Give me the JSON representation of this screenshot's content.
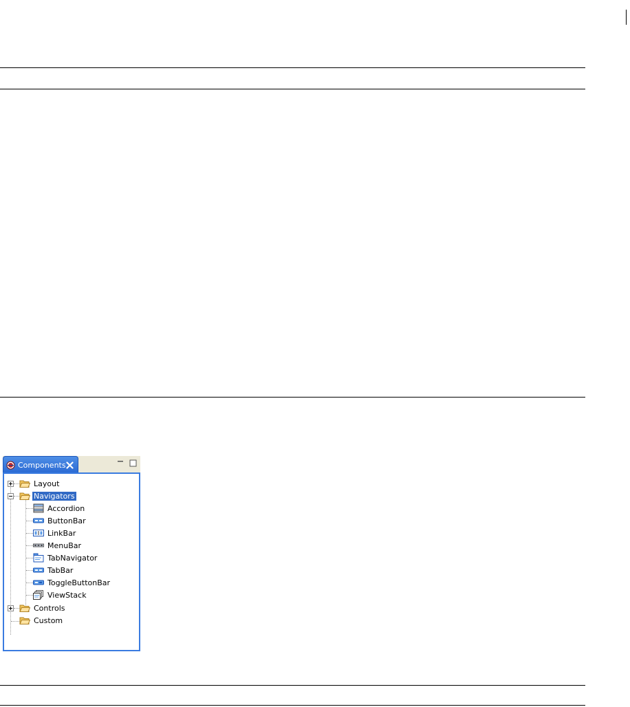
{
  "panel": {
    "tab": {
      "title": "Components",
      "icon": "components-view-icon",
      "close_icon": "close-icon"
    },
    "window_controls": [
      "minimize-icon",
      "maximize-icon"
    ]
  },
  "tree": {
    "layout": {
      "label": "Layout",
      "expanded": false,
      "icon": "folder-icon"
    },
    "navigators": {
      "label": "Navigators",
      "expanded": true,
      "selected": true,
      "icon": "folder-icon",
      "children": [
        {
          "label": "Accordion",
          "icon": "accordion-icon"
        },
        {
          "label": "ButtonBar",
          "icon": "buttonbar-icon"
        },
        {
          "label": "LinkBar",
          "icon": "linkbar-icon"
        },
        {
          "label": "MenuBar",
          "icon": "menubar-icon"
        },
        {
          "label": "TabNavigator",
          "icon": "tabnavigator-icon"
        },
        {
          "label": "TabBar",
          "icon": "tabbar-icon"
        },
        {
          "label": "ToggleButtonBar",
          "icon": "togglebuttonbar-icon"
        },
        {
          "label": "ViewStack",
          "icon": "viewstack-icon"
        }
      ]
    },
    "controls": {
      "label": "Controls",
      "expanded": false,
      "icon": "folder-icon"
    },
    "custom": {
      "label": "Custom",
      "icon": "folder-icon"
    }
  },
  "colors": {
    "accent": "#3a7be0",
    "selection": "#316ac5",
    "folder": "#f2c55c"
  }
}
